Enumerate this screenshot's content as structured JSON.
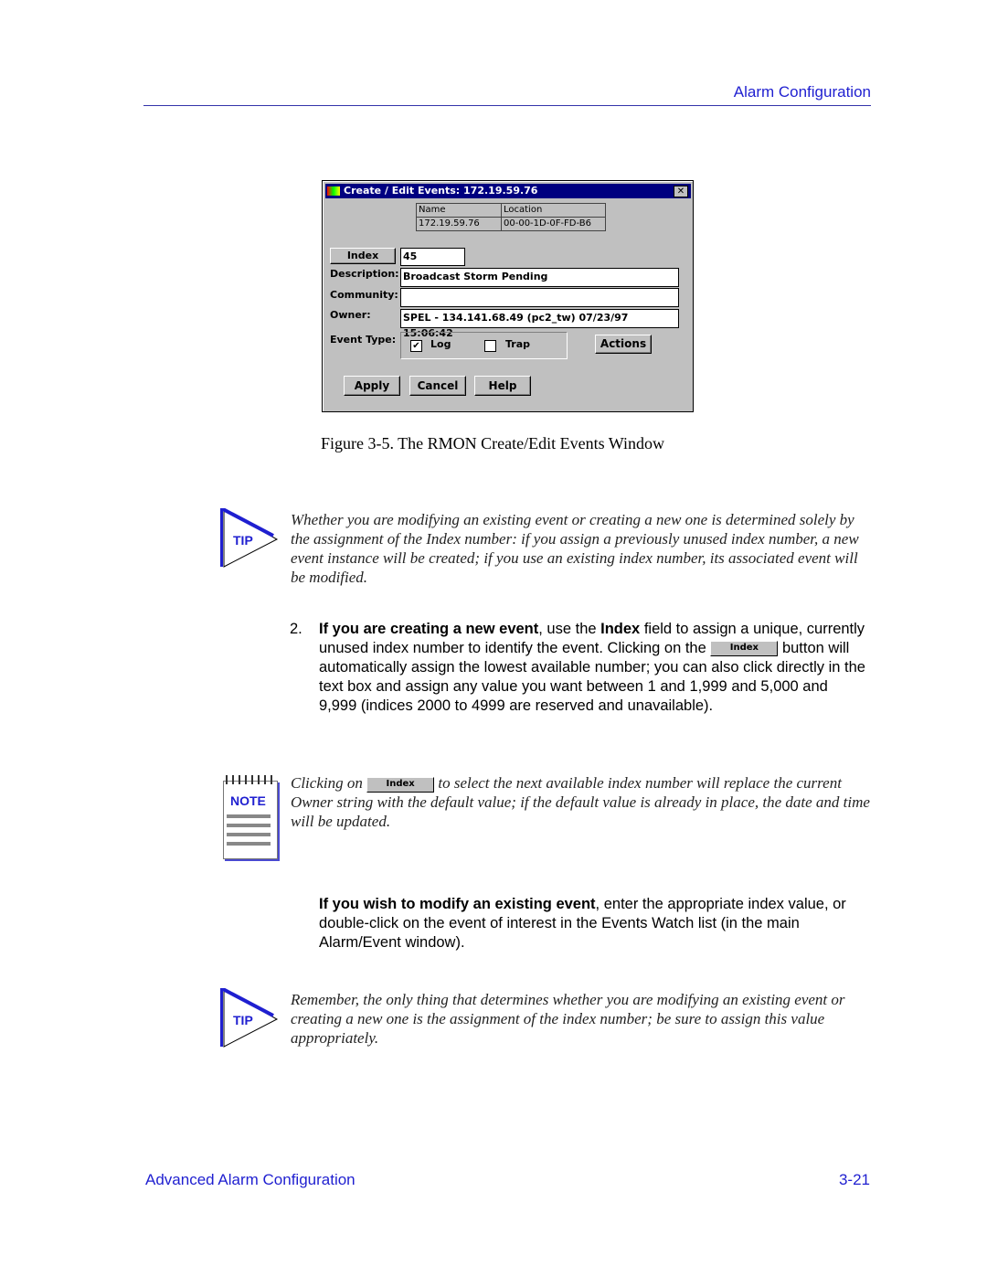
{
  "header": {
    "section": "Alarm Configuration"
  },
  "dialog": {
    "title": "Create / Edit Events: 172.19.59.76",
    "close": "✕",
    "table": {
      "headers": [
        "Name",
        "Location"
      ],
      "row": [
        "172.19.59.76",
        "00-00-1D-0F-FD-B6"
      ]
    },
    "index_button": "Index",
    "index_value": "45",
    "description_label": "Description:",
    "description_value": "Broadcast Storm Pending",
    "community_label": "Community:",
    "community_value": "",
    "owner_label": "Owner:",
    "owner_value": "SPEL - 134.141.68.49 (pc2_tw) 07/23/97 15:06:42",
    "event_type_label": "Event Type:",
    "log_label": "Log",
    "log_checked": true,
    "trap_label": "Trap",
    "trap_checked": false,
    "actions": "Actions",
    "apply": "Apply",
    "cancel": "Cancel",
    "help": "Help"
  },
  "caption": "Figure 3-5.  The RMON Create/Edit Events Window",
  "tip1": {
    "badge": "TIP",
    "text": "Whether you are modifying an existing event or creating a new one is determined solely by the assignment of the Index number: if you assign a previously unused index number, a new event instance will be created; if you use an existing index number, its associated event will be modified."
  },
  "step2": {
    "number": "2.",
    "bold1": "If you are creating a new event",
    "t1": ", use the ",
    "bold2": "Index",
    "t2": " field to assign a unique, currently unused index number to identify the event. Clicking on the ",
    "button": "Index",
    "t3": " button will automatically assign the lowest available number; you can also click directly in the text box and assign any value you want between 1 and 1,999 and 5,000 and 9,999 (indices 2000 to 4999 are reserved and unavailable)."
  },
  "note": {
    "badge": "NOTE",
    "t1": "Clicking on ",
    "button": "Index",
    "t2": " to select the next available index number will replace the current Owner string with the default value; if the default value is already in place, the date and time will be updated."
  },
  "modify": {
    "bold": "If you wish to modify an existing event",
    "text": ", enter the appropriate index value, or double-click on the event of interest in the Events Watch list (in the main Alarm/Event window)."
  },
  "tip2": {
    "badge": "TIP",
    "text": "Remember, the only thing that determines whether you are modifying an existing event or creating a new one is the assignment of the index number; be sure to assign this value appropriately."
  },
  "footer": {
    "chapter": "Advanced Alarm Configuration",
    "page": "3-21"
  },
  "colors": {
    "accent": "#1f1fd0",
    "titlebar": "#000080"
  }
}
